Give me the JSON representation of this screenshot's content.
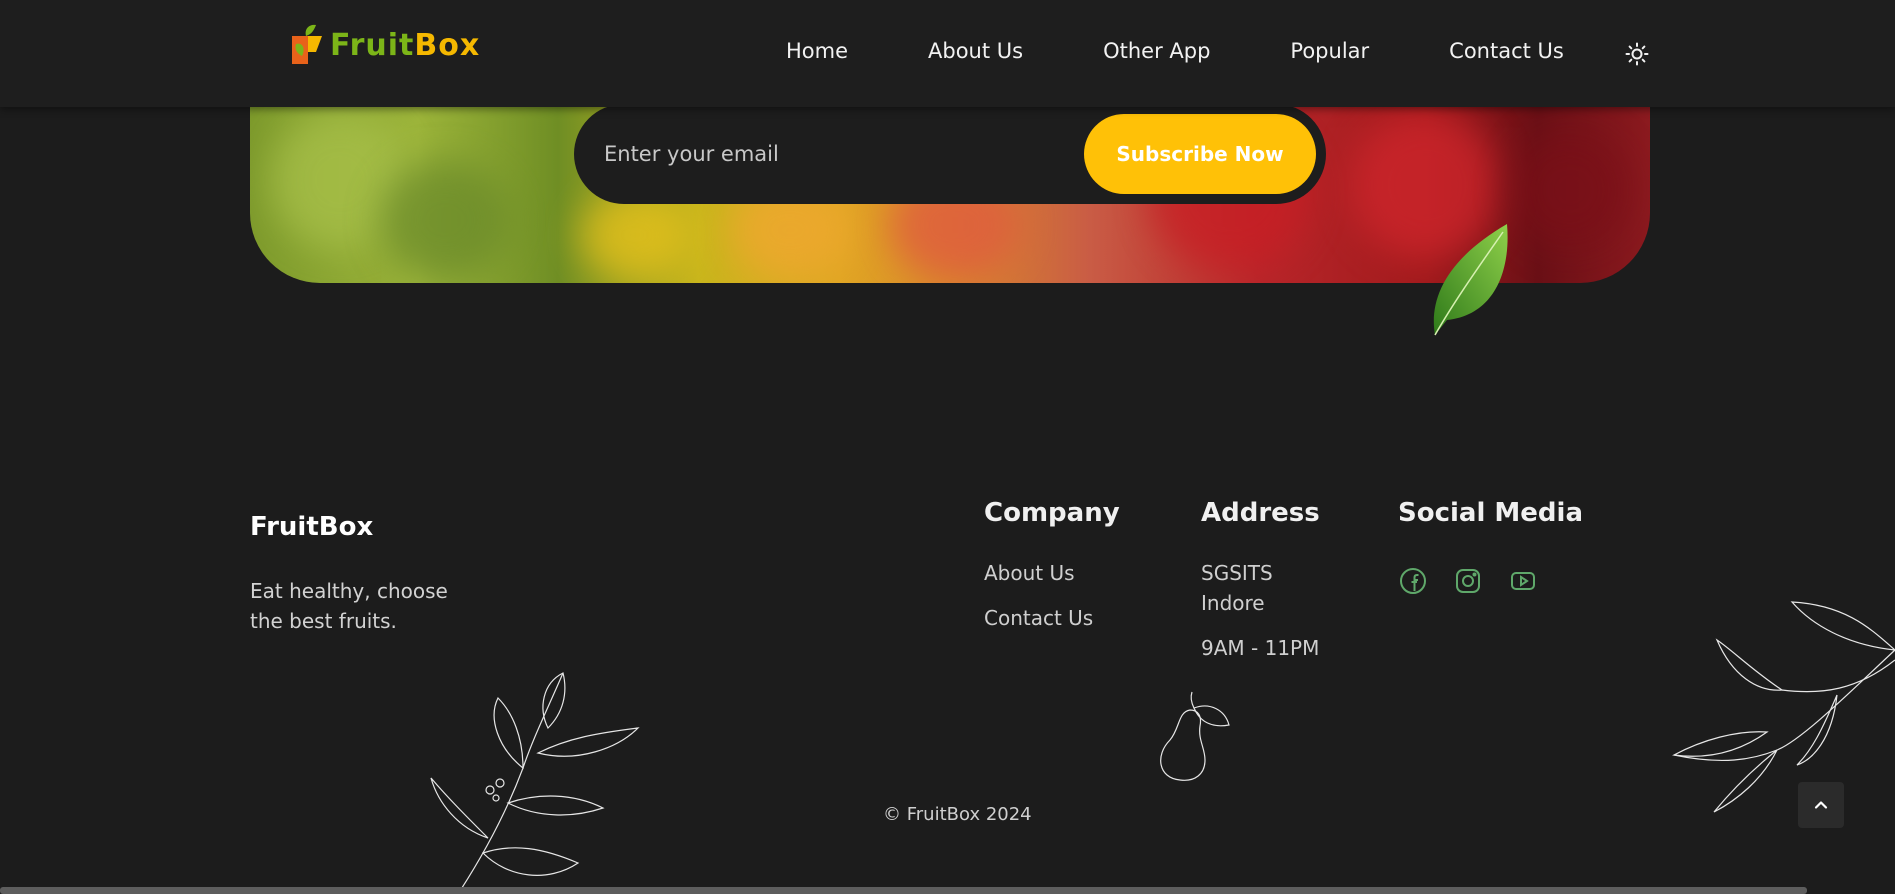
{
  "header": {
    "logo": {
      "text_main": "Fruit",
      "text_accent": "Box",
      "icon": "fruitbox-logo-icon"
    },
    "nav": [
      {
        "label": "Home"
      },
      {
        "label": "About Us"
      },
      {
        "label": "Other App"
      },
      {
        "label": "Popular"
      },
      {
        "label": "Contact Us"
      }
    ],
    "theme_icon": "sun-icon"
  },
  "newsletter": {
    "email_placeholder": "Enter your email",
    "email_value": "",
    "subscribe_label": "Subscribe Now",
    "leaf_icon": "leaf-icon"
  },
  "footer": {
    "brand": "FruitBox",
    "tagline": "Eat healthy, choose the best fruits.",
    "company": {
      "title": "Company",
      "links": [
        "About Us",
        "Contact Us"
      ]
    },
    "address": {
      "title": "Address",
      "lines": [
        "SGSITS Indore",
        "9AM - 11PM"
      ]
    },
    "social": {
      "title": "Social Media",
      "icons": [
        "facebook-icon",
        "instagram-icon",
        "youtube-icon"
      ],
      "color": "#5fa86a"
    },
    "copyright": "© FruitBox 2024",
    "scroll_top_icon": "chevron-up-icon"
  },
  "colors": {
    "background": "#1c1c1c",
    "accent": "#ffc107",
    "brand_green": "#7cb518"
  }
}
